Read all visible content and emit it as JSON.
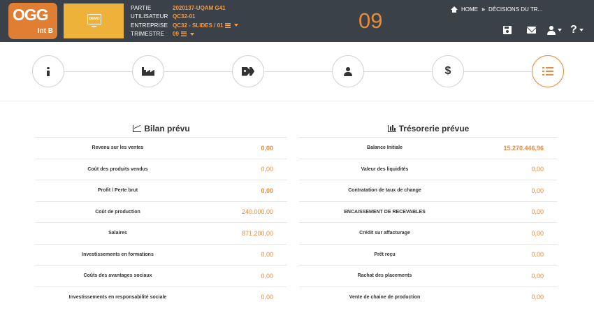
{
  "header": {
    "logo": {
      "big": "OGG",
      "small": "Int B"
    },
    "demo_label": "DEMO",
    "info": [
      {
        "label": "PARTIE",
        "value": "2020137-UQAM G41",
        "list_icon": false,
        "caret": false
      },
      {
        "label": "UTILISATEUR",
        "value": "QC32-01",
        "list_icon": false,
        "caret": false
      },
      {
        "label": "ENTREPRISE",
        "value": "QC32 - SLIDES / 01",
        "list_icon": true,
        "caret": true
      },
      {
        "label": "TRIMESTRE",
        "value": "09",
        "list_icon": true,
        "caret": true
      }
    ],
    "quarter": "09",
    "breadcrumb": {
      "home": "HOME",
      "separator": "»",
      "current": "DÉCISIONS DU TR..."
    },
    "accent_color": "#e88a3a",
    "bar_color": "#3b4148"
  },
  "steps": [
    {
      "icon": "info-icon"
    },
    {
      "icon": "factory-icon"
    },
    {
      "icon": "tags-icon"
    },
    {
      "icon": "user-icon"
    },
    {
      "icon": "dollar-icon"
    },
    {
      "icon": "list-icon",
      "active": true
    }
  ],
  "bilan": {
    "title": "Bilan prévu",
    "rows": [
      {
        "label": "Revenu sur les ventes",
        "value": "0,00",
        "bold": true
      },
      {
        "label": "Coût des produits vendus",
        "value": "0,00",
        "bold": false
      },
      {
        "label": "Profit / Perte brut",
        "value": "0,00",
        "bold": true
      },
      {
        "label": "Coût de production",
        "value": "240.000,00",
        "bold": false
      },
      {
        "label": "Salaires",
        "value": "871.200,00",
        "bold": false
      },
      {
        "label": "Investissements en formations",
        "value": "0,00",
        "bold": false
      },
      {
        "label": "Coûts des avantages sociaux",
        "value": "0,00",
        "bold": false
      },
      {
        "label": "Investissements en responsabilité sociale",
        "value": "0,00",
        "bold": false
      }
    ]
  },
  "tresorerie": {
    "title": "Trésorerie prévue",
    "rows": [
      {
        "label": "Balance Initiale",
        "value": "15.270.446,96",
        "bold": true
      },
      {
        "label": "Valeur des liquidités",
        "value": "0,00",
        "bold": false
      },
      {
        "label": "Contratation de taux de change",
        "value": "0,00",
        "bold": false
      },
      {
        "label": "ENCAISSEMENT DE RECEVABLES",
        "value": "0,00",
        "bold": false
      },
      {
        "label": "Crédit sur affacturage",
        "value": "0,00",
        "bold": false
      },
      {
        "label": "Prêt reçu",
        "value": "0,00",
        "bold": false
      },
      {
        "label": "Rachat des placements",
        "value": "0,00",
        "bold": false
      },
      {
        "label": "Vente de chaine de production",
        "value": "0,00",
        "bold": false
      }
    ]
  }
}
